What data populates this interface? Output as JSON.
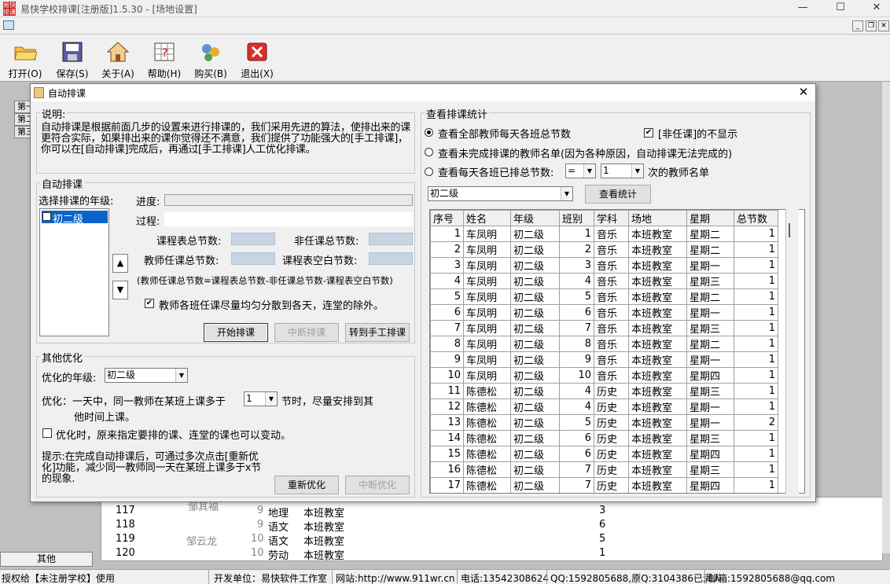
{
  "window": {
    "title": "易快学校排课[注册版]1.5.30 - [场地设置]",
    "app_icon": "app-logo-icon"
  },
  "toolbar": [
    {
      "label": "打开(O)",
      "icon": "folder-open-icon"
    },
    {
      "label": "保存(S)",
      "icon": "save-icon"
    },
    {
      "label": "关于(A)",
      "icon": "home-icon"
    },
    {
      "label": "帮助(H)",
      "icon": "help-icon"
    },
    {
      "label": "购买(B)",
      "icon": "cart-icon"
    },
    {
      "label": "退出(X)",
      "icon": "exit-icon"
    }
  ],
  "leftnav": {
    "items": [
      "第一",
      "第二",
      "第三"
    ],
    "bottom": "其他"
  },
  "bg_table": {
    "rows": [
      {
        "no": "117",
        "teacher": "邹其福",
        "cls": "9",
        "subj": "地理",
        "room": "本班教室",
        "n": "3"
      },
      {
        "no": "118",
        "teacher": "",
        "cls": "9",
        "subj": "语文",
        "room": "本班教室",
        "n": "6"
      },
      {
        "no": "119",
        "teacher": "邹云龙",
        "cls": "10",
        "subj": "语文",
        "room": "本班教室",
        "n": "5"
      },
      {
        "no": "120",
        "teacher": "",
        "cls": "10",
        "subj": "劳动",
        "room": "本班教室",
        "n": "1"
      }
    ]
  },
  "status": [
    "授权给【未注册学校】使用",
    "开发单位：易快软件工作室",
    "网站:http://www.911wr.cn",
    "电话:13542308624",
    "QQ:1592805688,原Q:3104386已满人",
    "邮箱:1592805688@qq.com"
  ],
  "dialog": {
    "title": "自动排课",
    "desc_group": "说明:",
    "desc": "自动排课是根据前面几步的设置来进行排课的，我们采用先进的算法，使排出来的课更符合实际，如果排出来的课你觉得还不满意，我们提供了功能强大的[手工排课]，你可以在[自动排课]完成后，再通过[手工排课]人工优化排课。",
    "auto_group": "自动排课",
    "grade_label": "选择排课的年级:",
    "grade_items": [
      "初二级"
    ],
    "progress_label": "进度:",
    "process_label": "过程:",
    "total_label": "课程表总节数:",
    "nonteach_label": "非任课总节数:",
    "teacher_total_label": "教师任课总节数:",
    "blank_label": "课程表空白节数:",
    "formula": "(教师任课总节数=课程表总节数-非任课总节数-课程表空白节数)",
    "even_check": "教师各班任课尽量均匀分散到各天，连堂的除外。",
    "btn_start": "开始排课",
    "btn_stop": "中断排课",
    "btn_manual": "转到手工排课",
    "opt_group": "其他优化",
    "opt_grade_label": "优化的年级:",
    "opt_grade": "初二级",
    "opt_line1": "优化：一天中，同一教师在某班上课多于",
    "opt_count": "1",
    "opt_line1b": "节时，尽量安排到其",
    "opt_line2": "他时间上课。",
    "opt_check": "优化时，原来指定要排的课、连堂的课也可以变动。",
    "tip": "提示:在完成自动排课后，可通过多次点击[重新优化]功能，减少同一教师同一天在某班上课多于x节的现象.",
    "btn_reopt": "重新优化",
    "btn_stopopt": "中断优化",
    "stats_group": "查看排课统计",
    "radio1": "查看全部教师每天各班总节数",
    "radio2": "查看未完成排课的教师名单(因为各种原因，自动排课无法完成的)",
    "radio3": "查看每天各班已排总节数:",
    "radio3_op": "=",
    "radio3_n": "1",
    "radio3_tail": "次的教师名单",
    "nonteach_check": "[非任课]的不显示",
    "stats_grade": "初二级",
    "btn_view": "查看统计",
    "grid_headers": [
      "序号",
      "姓名",
      "年级",
      "班别",
      "学科",
      "场地",
      "星期",
      "总节数"
    ],
    "grid_rows": [
      [
        "1",
        "车凤明",
        "初二级",
        "1",
        "音乐",
        "本班教室",
        "星期二",
        "1"
      ],
      [
        "2",
        "车凤明",
        "初二级",
        "2",
        "音乐",
        "本班教室",
        "星期二",
        "1"
      ],
      [
        "3",
        "车凤明",
        "初二级",
        "3",
        "音乐",
        "本班教室",
        "星期一",
        "1"
      ],
      [
        "4",
        "车凤明",
        "初二级",
        "4",
        "音乐",
        "本班教室",
        "星期三",
        "1"
      ],
      [
        "5",
        "车凤明",
        "初二级",
        "5",
        "音乐",
        "本班教室",
        "星期二",
        "1"
      ],
      [
        "6",
        "车凤明",
        "初二级",
        "6",
        "音乐",
        "本班教室",
        "星期一",
        "1"
      ],
      [
        "7",
        "车凤明",
        "初二级",
        "7",
        "音乐",
        "本班教室",
        "星期三",
        "1"
      ],
      [
        "8",
        "车凤明",
        "初二级",
        "8",
        "音乐",
        "本班教室",
        "星期二",
        "1"
      ],
      [
        "9",
        "车凤明",
        "初二级",
        "9",
        "音乐",
        "本班教室",
        "星期一",
        "1"
      ],
      [
        "10",
        "车凤明",
        "初二级",
        "10",
        "音乐",
        "本班教室",
        "星期四",
        "1"
      ],
      [
        "11",
        "陈德松",
        "初二级",
        "4",
        "历史",
        "本班教室",
        "星期三",
        "1"
      ],
      [
        "12",
        "陈德松",
        "初二级",
        "4",
        "历史",
        "本班教室",
        "星期一",
        "1"
      ],
      [
        "13",
        "陈德松",
        "初二级",
        "5",
        "历史",
        "本班教室",
        "星期一",
        "2"
      ],
      [
        "14",
        "陈德松",
        "初二级",
        "6",
        "历史",
        "本班教室",
        "星期三",
        "1"
      ],
      [
        "15",
        "陈德松",
        "初二级",
        "6",
        "历史",
        "本班教室",
        "星期四",
        "1"
      ],
      [
        "16",
        "陈德松",
        "初二级",
        "7",
        "历史",
        "本班教室",
        "星期三",
        "1"
      ],
      [
        "17",
        "陈德松",
        "初二级",
        "7",
        "历史",
        "本班教室",
        "星期四",
        "1"
      ],
      [
        "18",
        "陈德松",
        "初二级",
        "8",
        "历史",
        "本班教室",
        "星期三",
        "1"
      ],
      [
        "19",
        "陈德松",
        "初二级",
        "8",
        "历史",
        "本班教室",
        "星期一",
        "1"
      ]
    ]
  }
}
